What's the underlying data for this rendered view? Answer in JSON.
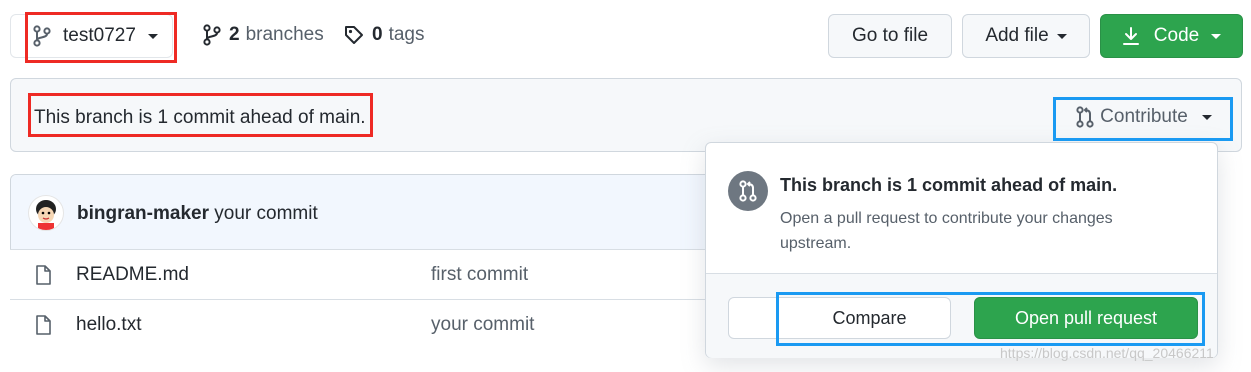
{
  "branch_select": {
    "name": "test0727"
  },
  "branches": {
    "count": "2",
    "label": "branches"
  },
  "tags": {
    "count": "0",
    "label": "tags"
  },
  "buttons": {
    "go_to_file": "Go to file",
    "add_file": "Add file",
    "code": "Code"
  },
  "ahead_bar": {
    "text": "This branch is 1 commit ahead of main.",
    "contribute": "Contribute"
  },
  "latest_commit": {
    "author": "bingran-maker",
    "message": "your commit"
  },
  "files": [
    {
      "name": "README.md",
      "message": "first commit"
    },
    {
      "name": "hello.txt",
      "message": "your commit"
    }
  ],
  "popover": {
    "title": "This branch is 1 commit ahead of main.",
    "description": "Open a pull request to contribute your changes upstream.",
    "compare": "Compare",
    "open_pr": "Open pull request"
  },
  "watermark": "https://blog.csdn.net/qq_20466211",
  "colors": {
    "green": "#2da44e",
    "annot_red": "#ee2a24",
    "annot_blue": "#1a9af2",
    "commit_bg": "#f2f7fe"
  }
}
